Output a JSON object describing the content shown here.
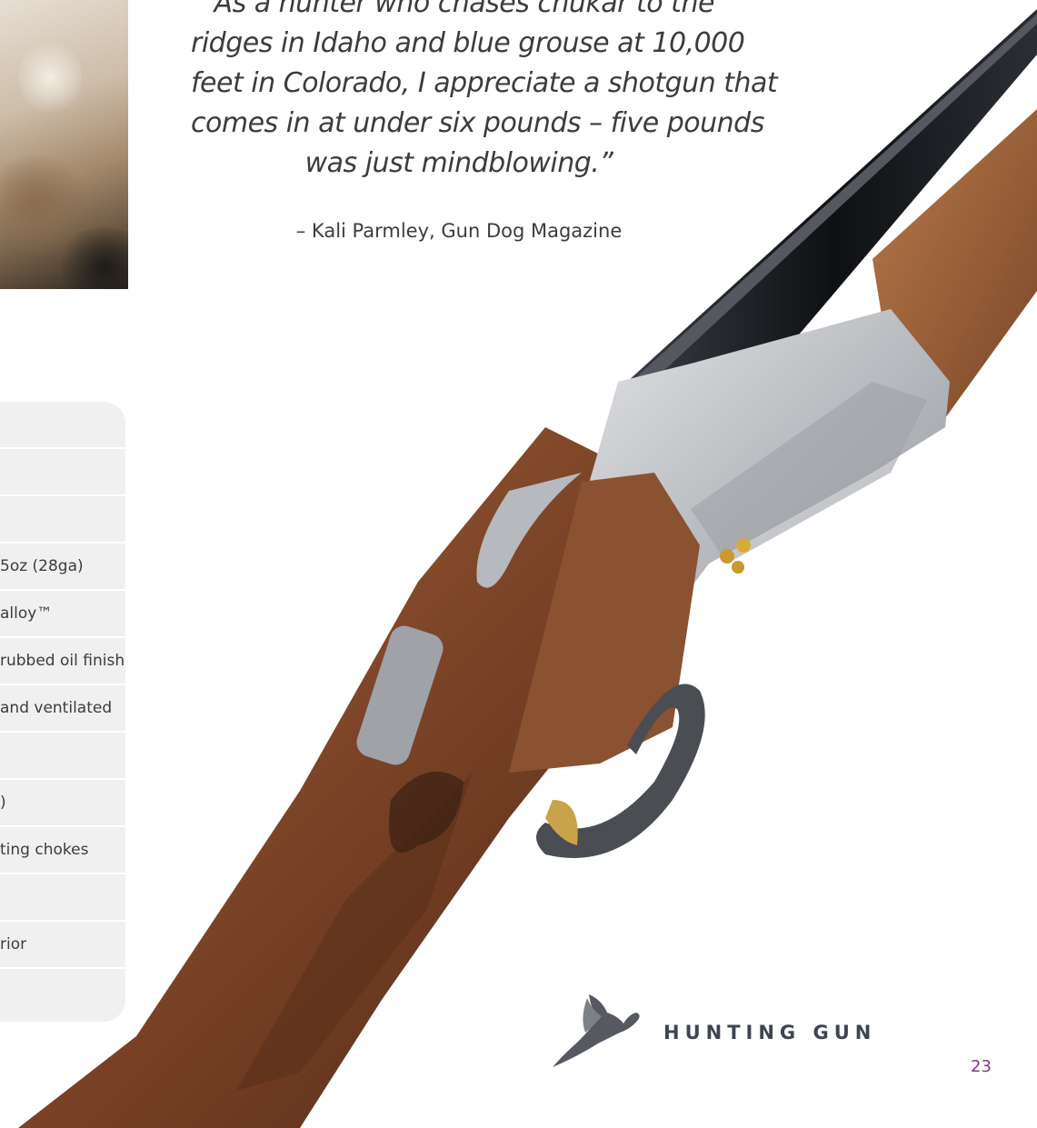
{
  "quote": {
    "lines": [
      "“As a hunter who chases chukar to the",
      "ridges in Idaho and blue grouse at 10,000",
      "feet in Colorado, I appreciate a shotgun that",
      "comes in at under six pounds – five pounds",
      "was just mindblowing.”"
    ],
    "attribution": "– Kali Parmley, Gun Dog Magazine"
  },
  "specs": [
    "",
    "",
    "",
    "5oz (28ga)",
    "alloy™",
    "rubbed oil finish",
    "and ventilated",
    "",
    ")",
    "ting chokes",
    "",
    "rior",
    ""
  ],
  "brand": {
    "label": "HUNTING GUN",
    "icon": "pheasant-icon"
  },
  "page_number": "23",
  "colors": {
    "page_number": "#7b3a86",
    "spec_panel": "#f0f0f1",
    "brand_text": "#3f4550",
    "wood": "#7a4226",
    "steel": "#c4c6c9",
    "barrel": "#1a1c20"
  }
}
